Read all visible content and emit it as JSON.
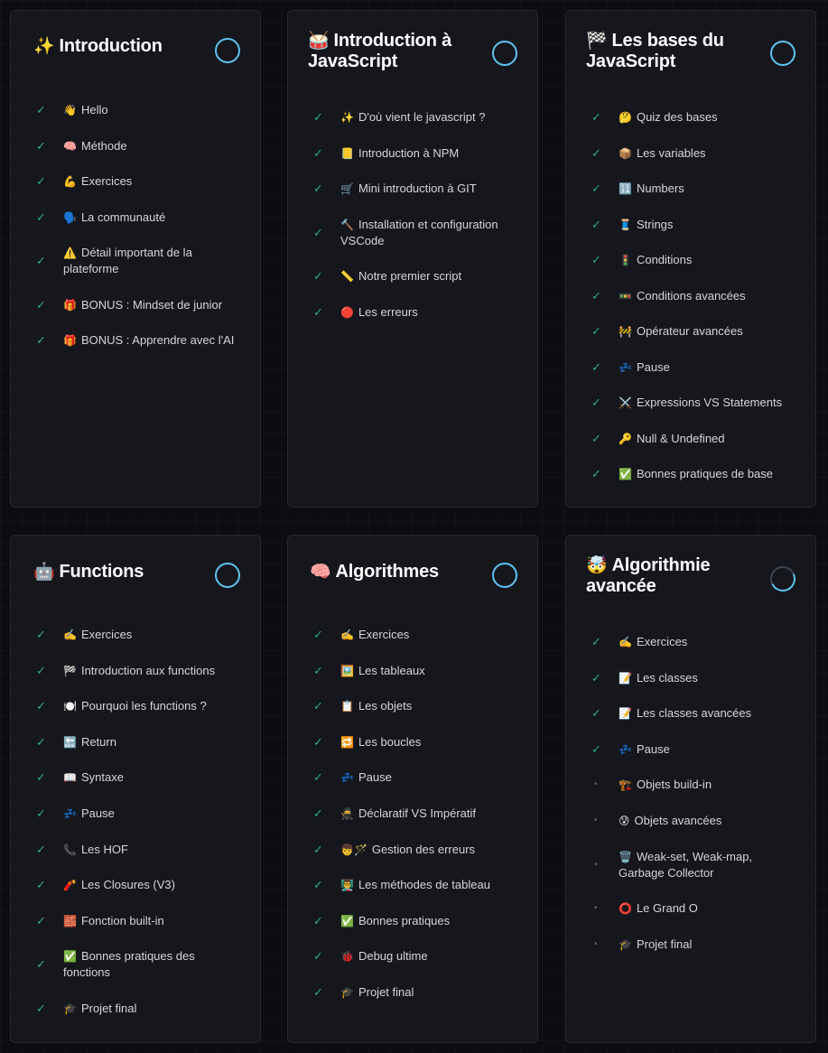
{
  "modules": [
    {
      "title": "Introduction",
      "emoji": "✨",
      "progress": 1.0,
      "lessons": [
        {
          "emoji": "👋",
          "label": "Hello",
          "done": true
        },
        {
          "emoji": "🧠",
          "label": "Méthode",
          "done": true
        },
        {
          "emoji": "💪",
          "label": "Exercices",
          "done": true
        },
        {
          "emoji": "🗣️",
          "label": "La communauté",
          "done": true
        },
        {
          "emoji": "⚠️",
          "label": "Détail important de la plateforme",
          "done": true
        },
        {
          "emoji": "🎁",
          "label": "BONUS : Mindset de junior",
          "done": true
        },
        {
          "emoji": "🎁",
          "label": "BONUS : Apprendre avec l'AI",
          "done": true
        }
      ]
    },
    {
      "title": "Introduction à JavaScript",
      "emoji": "🥁",
      "progress": 1.0,
      "lessons": [
        {
          "emoji": "✨",
          "label": "D'où vient le javascript ?",
          "done": true
        },
        {
          "emoji": "📒",
          "label": "Introduction à NPM",
          "done": true
        },
        {
          "emoji": "🛒",
          "label": "Mini introduction à GIT",
          "done": true
        },
        {
          "emoji": "🔨",
          "label": "Installation et configuration VSCode",
          "done": true
        },
        {
          "emoji": "📏",
          "label": "Notre premier script",
          "done": true
        },
        {
          "emoji": "🔴",
          "label": "Les erreurs",
          "done": true
        }
      ]
    },
    {
      "title": "Les bases du JavaScript",
      "emoji": "🏁",
      "progress": 1.0,
      "lessons": [
        {
          "emoji": "🤔",
          "label": "Quiz des bases",
          "done": true
        },
        {
          "emoji": "📦",
          "label": "Les variables",
          "done": true
        },
        {
          "emoji": "🔢",
          "label": "Numbers",
          "done": true
        },
        {
          "emoji": "🧵",
          "label": "Strings",
          "done": true
        },
        {
          "emoji": "🚦",
          "label": "Conditions",
          "done": true
        },
        {
          "emoji": "🚥",
          "label": "Conditions avancées",
          "done": true
        },
        {
          "emoji": "🚧",
          "label": "Opérateur avancées",
          "done": true
        },
        {
          "emoji": "💤",
          "label": "Pause",
          "done": true
        },
        {
          "emoji": "⚔️",
          "label": "Expressions VS Statements",
          "done": true
        },
        {
          "emoji": "🔑",
          "label": "Null & Undefined",
          "done": true
        },
        {
          "emoji": "✅",
          "label": "Bonnes pratiques de base",
          "done": true
        }
      ]
    },
    {
      "title": "Functions",
      "emoji": "🤖",
      "progress": 1.0,
      "lessons": [
        {
          "emoji": "✍️",
          "label": "Exercices",
          "done": true
        },
        {
          "emoji": "🏁",
          "label": "Introduction aux functions",
          "done": true
        },
        {
          "emoji": "🍽️",
          "label": "Pourquoi les functions ?",
          "done": true
        },
        {
          "emoji": "🔙",
          "label": "Return",
          "done": true
        },
        {
          "emoji": "📖",
          "label": "Syntaxe",
          "done": true
        },
        {
          "emoji": "💤",
          "label": "Pause",
          "done": true
        },
        {
          "emoji": "📞",
          "label": "Les HOF",
          "done": true
        },
        {
          "emoji": "🧨",
          "label": "Les Closures (V3)",
          "done": true
        },
        {
          "emoji": "🧱",
          "label": "Fonction built-in",
          "done": true
        },
        {
          "emoji": "✅",
          "label": "Bonnes pratiques des fonctions",
          "done": true
        },
        {
          "emoji": "🎓",
          "label": "Projet final",
          "done": true
        }
      ]
    },
    {
      "title": "Algorithmes",
      "emoji": "🧠",
      "progress": 1.0,
      "lessons": [
        {
          "emoji": "✍️",
          "label": "Exercices",
          "done": true
        },
        {
          "emoji": "🖼️",
          "label": "Les tableaux",
          "done": true
        },
        {
          "emoji": "📋",
          "label": "Les objets",
          "done": true
        },
        {
          "emoji": "🔁",
          "label": "Les boucles",
          "done": true
        },
        {
          "emoji": "💤",
          "label": "Pause",
          "done": true
        },
        {
          "emoji": "🥷",
          "label": "Déclaratif VS Impératif",
          "done": true
        },
        {
          "emoji": "👦🪄",
          "label": "Gestion des erreurs",
          "done": true
        },
        {
          "emoji": "👨‍🏫",
          "label": "Les méthodes de tableau",
          "done": true
        },
        {
          "emoji": "✅",
          "label": "Bonnes pratiques",
          "done": true
        },
        {
          "emoji": "🐞",
          "label": "Debug ultime",
          "done": true
        },
        {
          "emoji": "🎓",
          "label": "Projet final",
          "done": true
        }
      ]
    },
    {
      "title": "Algorithmie avancée",
      "emoji": "🤯",
      "progress": 0.4,
      "lessons": [
        {
          "emoji": "✍️",
          "label": "Exercices",
          "done": true
        },
        {
          "emoji": "📝",
          "label": "Les classes",
          "done": true
        },
        {
          "emoji": "📝",
          "label": "Les classes avancées",
          "done": true
        },
        {
          "emoji": "💤",
          "label": "Pause",
          "done": true
        },
        {
          "emoji": "🏗️",
          "label": "Objets build-in",
          "done": false
        },
        {
          "emoji": "😰",
          "label": "Objets avancées",
          "done": false
        },
        {
          "emoji": "🗑️",
          "label": "Weak-set, Weak-map, Garbage Collector",
          "done": false
        },
        {
          "emoji": "⭕",
          "label": "Le Grand O",
          "done": false
        },
        {
          "emoji": "🎓",
          "label": "Projet final",
          "done": false
        }
      ]
    }
  ],
  "icons": {
    "done": "✓",
    "pending": "•"
  },
  "colors": {
    "check": "#2fae78",
    "progress_ring": "#5ec3f0",
    "card_bg": "#15171d",
    "page_bg": "#0c0d12"
  }
}
